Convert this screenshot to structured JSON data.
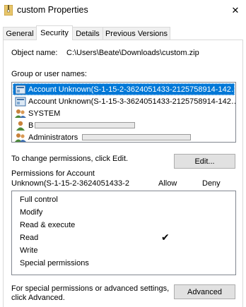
{
  "window": {
    "title": "custom Properties",
    "close_glyph": "✕"
  },
  "tabs": [
    {
      "label": "General",
      "active": false
    },
    {
      "label": "Security",
      "active": true
    },
    {
      "label": "Details",
      "active": false
    },
    {
      "label": "Previous Versions",
      "active": false
    }
  ],
  "object": {
    "label": "Object name:",
    "value": "C:\\Users\\Beate\\Downloads\\custom.zip"
  },
  "groups": {
    "label": "Group or user names:",
    "items": [
      {
        "label": "Account Unknown(S-1-15-2-3624051433-2125758914-142…",
        "icon": "unknown-account-icon",
        "selected": true
      },
      {
        "label": "Account Unknown(S-1-15-3-3624051433-2125758914-142…",
        "icon": "unknown-account-icon",
        "selected": false
      },
      {
        "label": "SYSTEM",
        "icon": "group-icon",
        "selected": false
      },
      {
        "label": "B",
        "icon": "user-icon",
        "selected": false
      },
      {
        "label": "Administrators",
        "icon": "group-icon",
        "selected": false
      }
    ]
  },
  "change_text": "To change permissions, click Edit.",
  "edit_button": "Edit...",
  "permissions": {
    "title_line1": "Permissions for Account",
    "title_line2": "Unknown(S-1-15-2-3624051433-2",
    "allow_header": "Allow",
    "deny_header": "Deny",
    "items": [
      "Full control",
      "Modify",
      "Read & execute",
      "Read",
      "Write",
      "Special permissions"
    ],
    "check_glyph": "✔"
  },
  "advanced": {
    "text_line1": "For special permissions or advanced settings,",
    "text_line2": "click Advanced.",
    "button": "Advanced"
  },
  "colors": {
    "selection": "#0078d7",
    "button_face": "#e1e1e1"
  }
}
